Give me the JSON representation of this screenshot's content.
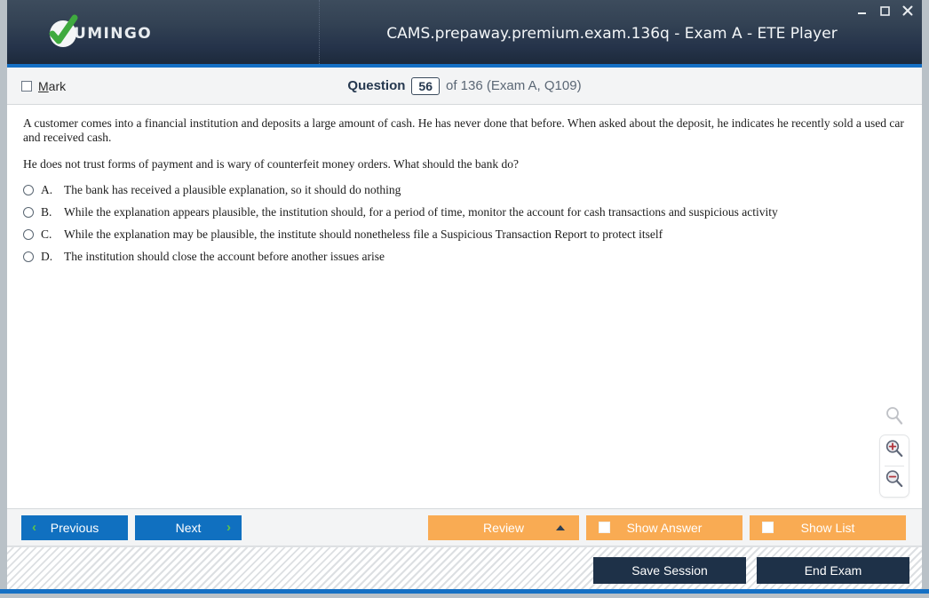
{
  "window": {
    "logo_text": "UMINGO",
    "logo_icon": "check-circle-logo",
    "title": "CAMS.prepaway.premium.exam.136q - Exam A - ETE Player",
    "controls": {
      "minimize": "–",
      "maximize": "☐",
      "close": "✕"
    }
  },
  "question_header": {
    "mark_label": "Mark",
    "mark_accelerator": "M",
    "mark_checked": false,
    "question_word": "Question",
    "question_number": "56",
    "of_text": "of 136 (Exam A, Q109)"
  },
  "question": {
    "paragraphs": [
      "A customer comes into a financial institution and deposits a large amount of cash. He has never done that before. When asked about the deposit, he indicates he recently sold a used car and received cash.",
      "He does not trust forms of payment and is wary of counterfeit money orders. What should the bank do?"
    ],
    "options": [
      {
        "letter": "A.",
        "text": "The bank has received a plausible explanation, so it should do nothing",
        "selected": false
      },
      {
        "letter": "B.",
        "text": "While the explanation appears plausible, the institution should, for a period of time, monitor the account for cash transactions and suspicious activity",
        "selected": false
      },
      {
        "letter": "C.",
        "text": "While the explanation may be plausible, the institute should nonetheless file a Suspicious Transaction Report to protect itself",
        "selected": false
      },
      {
        "letter": "D.",
        "text": "The institution should close the account before another issues arise",
        "selected": false
      }
    ]
  },
  "zoom_tools": {
    "search_icon": "magnifier-icon",
    "zoom_in_icon": "zoom-in-icon",
    "zoom_out_icon": "zoom-out-icon"
  },
  "action_bar": {
    "previous_label": "Previous",
    "previous_chevron": "‹",
    "next_label": "Next",
    "next_chevron": "›",
    "review_label": "Review",
    "show_answer_label": "Show Answer",
    "show_answer_checked": false,
    "show_list_label": "Show List",
    "show_list_checked": false
  },
  "status_bar": {
    "save_session_label": "Save Session",
    "end_exam_label": "End Exam"
  },
  "colors": {
    "titlebar_dark": "#1b2838",
    "accent_blue": "#1570c4",
    "nav_button_blue": "#1070c0",
    "chevron_green": "#5cc44a",
    "orange": "#f9ab53",
    "dark_navy_button": "#1e3148"
  }
}
